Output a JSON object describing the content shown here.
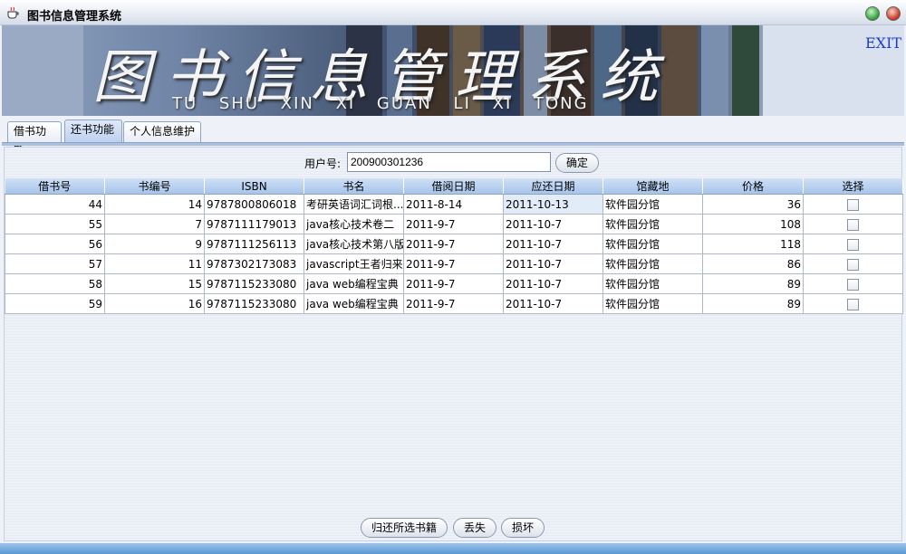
{
  "window": {
    "title": "图书信息管理系统",
    "icon": "coffee-cup-icon"
  },
  "banner": {
    "title": "图书信息管理系统",
    "pinyin": "TU SHU XIN XI GUAN LI XI TONG",
    "exit_label": "EXIT"
  },
  "tabs": [
    {
      "label": "借书功能",
      "active": false
    },
    {
      "label": "还书功能",
      "active": true
    },
    {
      "label": "个人信息维护",
      "active": false
    }
  ],
  "search": {
    "label": "用户号:",
    "value": "200900301236",
    "confirm_label": "确定"
  },
  "table": {
    "columns": [
      "借书号",
      "书编号",
      "ISBN",
      "书名",
      "借阅日期",
      "应还日期",
      "馆藏地",
      "价格",
      "选择"
    ],
    "rows": [
      {
        "borrow_no": "44",
        "book_no": "14",
        "isbn": "9787800806018",
        "title": "考研英语词汇词根...",
        "borrow_date": "2011-8-14",
        "due_date": "2011-10-13",
        "location": "软件园分馆",
        "price": "36"
      },
      {
        "borrow_no": "55",
        "book_no": "7",
        "isbn": "9787111179013",
        "title": "java核心技术卷二",
        "borrow_date": "2011-9-7",
        "due_date": "2011-10-7",
        "location": "软件园分馆",
        "price": "108"
      },
      {
        "borrow_no": "56",
        "book_no": "9",
        "isbn": "9787111256113",
        "title": "java核心技术第八版",
        "borrow_date": "2011-9-7",
        "due_date": "2011-10-7",
        "location": "软件园分馆",
        "price": "118"
      },
      {
        "borrow_no": "57",
        "book_no": "11",
        "isbn": "9787302173083",
        "title": "javascript王者归来",
        "borrow_date": "2011-9-7",
        "due_date": "2011-10-7",
        "location": "软件园分馆",
        "price": "86"
      },
      {
        "borrow_no": "58",
        "book_no": "15",
        "isbn": "9787115233080",
        "title": "java web编程宝典",
        "borrow_date": "2011-9-7",
        "due_date": "2011-10-7",
        "location": "软件园分馆",
        "price": "89"
      },
      {
        "borrow_no": "59",
        "book_no": "16",
        "isbn": "9787115233080",
        "title": "java web编程宝典",
        "borrow_date": "2011-9-7",
        "due_date": "2011-10-7",
        "location": "软件园分馆",
        "price": "89"
      }
    ]
  },
  "actions": {
    "return_label": "归还所选书籍",
    "lost_label": "丢失",
    "damage_label": "损坏"
  }
}
